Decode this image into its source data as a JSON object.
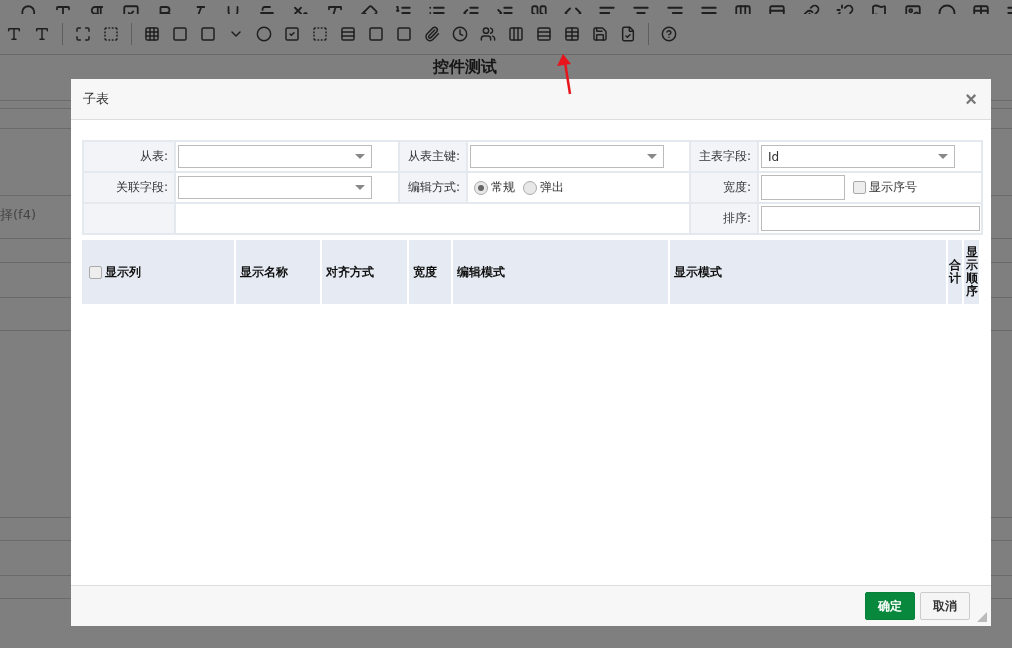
{
  "page": {
    "title": "控件测试",
    "field_hint": "择(f4)"
  },
  "dialog": {
    "title": "子表",
    "close": "×",
    "form": [
      [
        {
          "kind": "select",
          "label": "从表:"
        },
        {
          "kind": "select",
          "label": "从表主键:"
        },
        {
          "kind": "select",
          "label": "主表字段:",
          "value": "Id"
        }
      ],
      [
        {
          "kind": "select",
          "label": "关联字段:"
        },
        {
          "kind": "radio",
          "label": "编辑方式:",
          "options": [
            {
              "label": "常规",
              "selected": true
            },
            {
              "label": "弹出",
              "selected": false
            }
          ]
        },
        {
          "kind": "input",
          "label": "宽度:",
          "checkbox": {
            "label": "显示序号",
            "checked": false
          }
        }
      ],
      [
        {
          "kind": "blank"
        },
        {
          "kind": "wide-input",
          "label": "排序:"
        }
      ]
    ],
    "columns": [
      {
        "kind": "check",
        "label": "显示列",
        "checked": false
      },
      {
        "kind": "text",
        "label": "显示名称"
      },
      {
        "kind": "text",
        "label": "对齐方式"
      },
      {
        "kind": "text",
        "label": "宽度"
      },
      {
        "kind": "text",
        "label": "编辑模式"
      },
      {
        "kind": "text",
        "label": "显示模式"
      },
      {
        "kind": "vertical",
        "label": "合计"
      },
      {
        "kind": "vertical",
        "label": "显示顺序"
      }
    ],
    "buttons": [
      {
        "kind": "primary",
        "label": "确定"
      },
      {
        "kind": "default",
        "label": "取消"
      }
    ]
  }
}
